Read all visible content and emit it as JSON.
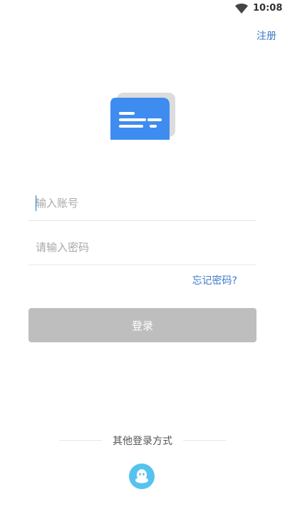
{
  "status_bar": {
    "time": "10:08",
    "wifi_icon": "wifi-icon"
  },
  "header": {
    "register_label": "注册"
  },
  "logo": {
    "icon": "message-card-logo",
    "primary_color": "#3f8cf0",
    "shadow_color": "#dcdcdc"
  },
  "form": {
    "account_placeholder": "输入账号",
    "account_value": "",
    "password_placeholder": "请输入密码",
    "password_value": "",
    "forgot_label": "忘记密码?",
    "login_label": "登录",
    "login_button_color": "#bebebe",
    "link_color": "#3b78c8"
  },
  "alt_login": {
    "label": "其他登录方式",
    "qq_icon": "qq-icon",
    "qq_color": "#56c3ee"
  }
}
